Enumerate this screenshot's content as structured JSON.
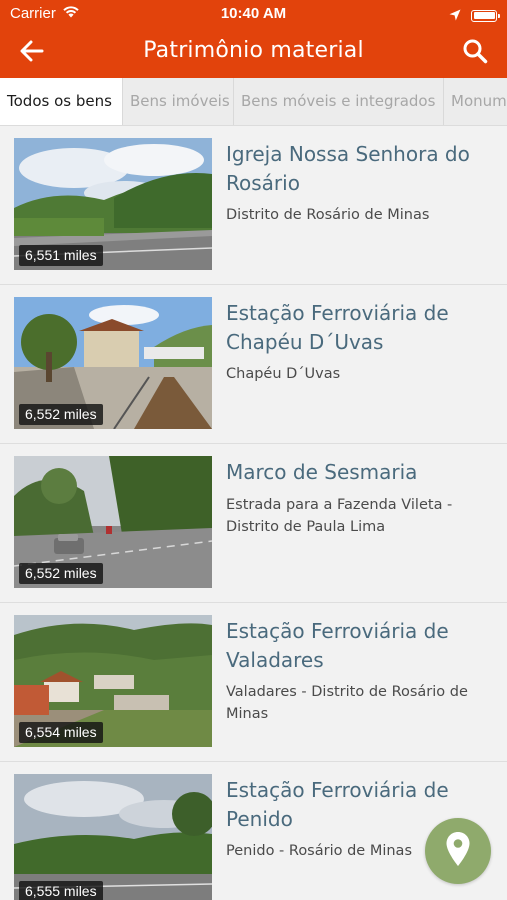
{
  "status_bar": {
    "carrier": "Carrier",
    "time": "10:40 AM"
  },
  "header": {
    "title": "Patrimônio material"
  },
  "tabs": [
    {
      "label": "Todos os bens",
      "active": true
    },
    {
      "label": "Bens imóveis",
      "active": false
    },
    {
      "label": "Bens móveis e integrados",
      "active": false
    },
    {
      "label": "Monum",
      "active": false
    }
  ],
  "items": [
    {
      "title": "Igreja Nossa Senhora do Rosário",
      "address": "Distrito de Rosário de Minas",
      "distance": "6,551 miles"
    },
    {
      "title": "Estação Ferroviária de Chapéu D´Uvas",
      "address": "Chapéu D´Uvas",
      "distance": "6,552 miles"
    },
    {
      "title": "Marco de Sesmaria",
      "address": "Estrada para a Fazenda Vileta - Distrito de Paula Lima",
      "distance": "6,552 miles"
    },
    {
      "title": "Estação Ferroviária de Valadares",
      "address": "Valadares - Distrito de Rosário de Minas",
      "distance": "6,554 miles"
    },
    {
      "title": "Estação Ferroviária de Penido",
      "address": "Penido - Rosário de Minas",
      "distance": "6,555 miles"
    }
  ],
  "colors": {
    "primary": "#e2430c",
    "title_text": "#4a6a7d",
    "fab": "#8faa6c"
  },
  "icons": [
    "wifi-icon",
    "location-arrow-icon",
    "battery-icon",
    "back-arrow-icon",
    "search-icon",
    "map-pin-icon"
  ]
}
